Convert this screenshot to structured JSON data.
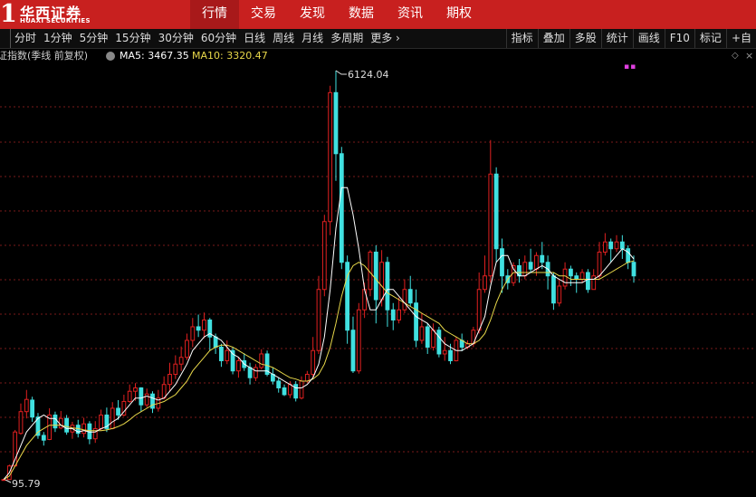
{
  "brand": {
    "mark": "1",
    "name_cn": "华西证券",
    "name_en": "HUAXI SECURITIES"
  },
  "nav": [
    "行情",
    "交易",
    "发现",
    "数据",
    "资讯",
    "期权"
  ],
  "periods": [
    "分时",
    "1分钟",
    "5分钟",
    "15分钟",
    "30分钟",
    "60分钟",
    "日线",
    "周线",
    "月线",
    "多周期",
    "更多"
  ],
  "tools": [
    "指标",
    "叠加",
    "多股",
    "统计",
    "画线",
    "F10",
    "标记",
    "+自"
  ],
  "info": {
    "title": "证指数(季线 前复权)",
    "ma5": "MA5: 3467.35",
    "ma10": "MA10: 3320.47",
    "diamond": "◇",
    "close": "×",
    "dots": "▪▪"
  },
  "chart_data": {
    "type": "candlestick",
    "title": "",
    "annotations": [
      {
        "text": "6124.04",
        "kind": "high"
      },
      {
        "text": "95.79",
        "kind": "low"
      }
    ],
    "grid": "horizontal-dotted",
    "colors": {
      "up": "#e02020",
      "down": "#40e0e0",
      "ma5": "#ffffff",
      "ma10": "#e8d84a",
      "grid": "#7a1a1a"
    },
    "candles": [
      [
        95.79,
        100,
        100,
        95.79
      ],
      [
        100,
        300,
        320,
        100
      ],
      [
        300,
        800,
        830,
        290
      ],
      [
        780,
        1100,
        1220,
        760
      ],
      [
        1100,
        1280,
        1420,
        1000
      ],
      [
        1270,
        1020,
        1320,
        950
      ],
      [
        1020,
        750,
        1080,
        700
      ],
      [
        750,
        680,
        800,
        600
      ],
      [
        690,
        1050,
        1150,
        680
      ],
      [
        1050,
        860,
        1100,
        800
      ],
      [
        860,
        1000,
        1110,
        840
      ],
      [
        1000,
        800,
        1050,
        760
      ],
      [
        800,
        900,
        950,
        700
      ],
      [
        900,
        780,
        980,
        720
      ],
      [
        780,
        920,
        1010,
        720
      ],
      [
        920,
        700,
        960,
        620
      ],
      [
        700,
        850,
        960,
        640
      ],
      [
        850,
        1050,
        1130,
        820
      ],
      [
        1050,
        850,
        1160,
        800
      ],
      [
        850,
        1150,
        1240,
        840
      ],
      [
        1150,
        1050,
        1270,
        980
      ],
      [
        1050,
        1250,
        1350,
        1030
      ],
      [
        1250,
        1400,
        1500,
        1230
      ],
      [
        1400,
        1450,
        1520,
        1260
      ],
      [
        1450,
        1200,
        1460,
        1100
      ],
      [
        1200,
        1360,
        1440,
        1160
      ],
      [
        1360,
        1150,
        1400,
        1080
      ],
      [
        1150,
        1300,
        1420,
        1100
      ],
      [
        1300,
        1500,
        1620,
        1280
      ],
      [
        1500,
        1650,
        1820,
        1400
      ],
      [
        1650,
        1800,
        1930,
        1580
      ],
      [
        1800,
        1900,
        2060,
        1700
      ],
      [
        1900,
        2150,
        2250,
        1860
      ],
      [
        2150,
        2350,
        2480,
        2050
      ],
      [
        2350,
        2300,
        2530,
        2200
      ],
      [
        2300,
        2450,
        2560,
        2180
      ],
      [
        2450,
        2200,
        2480,
        2000
      ],
      [
        2200,
        2050,
        2250,
        1950
      ],
      [
        2050,
        1850,
        2100,
        1760
      ],
      [
        1850,
        2000,
        2150,
        1800
      ],
      [
        2000,
        1700,
        2050,
        1650
      ],
      [
        1700,
        1850,
        1900,
        1600
      ],
      [
        1850,
        1750,
        1960,
        1700
      ],
      [
        1750,
        1600,
        1820,
        1500
      ],
      [
        1600,
        1750,
        1800,
        1550
      ],
      [
        1750,
        1950,
        2020,
        1720
      ],
      [
        1950,
        1650,
        2000,
        1620
      ],
      [
        1650,
        1550,
        1750,
        1500
      ],
      [
        1550,
        1450,
        1600,
        1380
      ],
      [
        1450,
        1350,
        1500,
        1330
      ],
      [
        1350,
        1500,
        1550,
        1300
      ],
      [
        1500,
        1300,
        1550,
        1250
      ],
      [
        1300,
        1550,
        1620,
        1280
      ],
      [
        1550,
        1650,
        1700,
        1520
      ],
      [
        1650,
        2000,
        2200,
        1600
      ],
      [
        2000,
        2900,
        3100,
        1950
      ],
      [
        2900,
        3900,
        4000,
        2800
      ],
      [
        3900,
        5800,
        5900,
        3700
      ],
      [
        5800,
        4900,
        6124.04,
        4500
      ],
      [
        4900,
        3300,
        5000,
        3200
      ],
      [
        3300,
        2300,
        3400,
        2100
      ],
      [
        2300,
        1700,
        2500,
        1670
      ],
      [
        1700,
        2600,
        2700,
        1660
      ],
      [
        2600,
        2900,
        3000,
        2480
      ],
      [
        2900,
        3450,
        3480,
        2800
      ],
      [
        3450,
        2750,
        3550,
        2400
      ],
      [
        2750,
        3300,
        3480,
        2650
      ],
      [
        3300,
        2600,
        3380,
        2350
      ],
      [
        2600,
        2450,
        2700,
        2300
      ],
      [
        2450,
        2600,
        2780,
        2400
      ],
      [
        2600,
        2900,
        3050,
        2550
      ],
      [
        2900,
        2700,
        3100,
        2650
      ],
      [
        2700,
        2150,
        2900,
        2050
      ],
      [
        2150,
        2350,
        2550,
        2100
      ],
      [
        2350,
        2050,
        2400,
        1950
      ],
      [
        2050,
        2300,
        2400,
        2000
      ],
      [
        2300,
        1950,
        2350,
        1900
      ],
      [
        1950,
        2000,
        2200,
        1850
      ],
      [
        2000,
        1850,
        2100,
        1800
      ],
      [
        1850,
        2150,
        2200,
        1840
      ],
      [
        2150,
        2050,
        2250,
        1990
      ],
      [
        2050,
        2100,
        2150,
        2020
      ],
      [
        2100,
        2300,
        2350,
        2050
      ],
      [
        2300,
        2900,
        3150,
        2250
      ],
      [
        2900,
        3100,
        3400,
        2850
      ],
      [
        3100,
        4600,
        5100,
        3000
      ],
      [
        4600,
        3500,
        4700,
        3300
      ],
      [
        3500,
        3100,
        3650,
        2850
      ],
      [
        3100,
        3000,
        3200,
        2900
      ],
      [
        3000,
        3250,
        3300,
        2950
      ],
      [
        3250,
        3100,
        3350,
        3000
      ],
      [
        3100,
        3300,
        3400,
        3050
      ],
      [
        3300,
        3200,
        3500,
        3150
      ],
      [
        3200,
        3400,
        3450,
        3100
      ],
      [
        3400,
        3300,
        3600,
        3200
      ],
      [
        3300,
        3100,
        3400,
        2900
      ],
      [
        3100,
        2700,
        3150,
        2600
      ],
      [
        2700,
        2950,
        3050,
        2650
      ],
      [
        2950,
        3200,
        3300,
        2900
      ],
      [
        3200,
        3100,
        3250,
        2950
      ],
      [
        3100,
        3050,
        3150,
        2850
      ],
      [
        3050,
        3150,
        3200,
        3000
      ],
      [
        3150,
        2900,
        3200,
        2850
      ],
      [
        2900,
        3100,
        3200,
        2900
      ],
      [
        3100,
        3450,
        3600,
        3050
      ],
      [
        3450,
        3600,
        3730,
        3400
      ],
      [
        3600,
        3500,
        3650,
        3300
      ],
      [
        3500,
        3600,
        3700,
        3450
      ],
      [
        3600,
        3500,
        3700,
        3350
      ],
      [
        3500,
        3300,
        3550,
        3200
      ],
      [
        3300,
        3100,
        3400,
        3000
      ]
    ],
    "ma5": [
      100,
      200,
      400,
      600,
      800,
      900,
      1000,
      1050,
      1000,
      1000,
      900,
      850,
      850,
      800,
      820,
      800,
      800,
      850,
      880,
      950,
      1000,
      1100,
      1200,
      1300,
      1300,
      1330,
      1300,
      1270,
      1300,
      1400,
      1500,
      1650,
      1800,
      2000,
      2100,
      2200,
      2250,
      2200,
      2150,
      2050,
      1950,
      1900,
      1800,
      1750,
      1700,
      1700,
      1700,
      1650,
      1600,
      1550,
      1500,
      1450,
      1450,
      1500,
      1600,
      1800,
      2200,
      2900,
      3800,
      4400,
      4400,
      4000,
      3500,
      2900,
      2600,
      2600,
      2750,
      2900,
      2900,
      2800,
      2700,
      2600,
      2500,
      2450,
      2400,
      2300,
      2200,
      2100,
      2050,
      2000,
      2000,
      2050,
      2100,
      2300,
      2500,
      2950,
      3300,
      3400,
      3400,
      3200,
      3100,
      3100,
      3150,
      3200,
      3250,
      3200,
      3100,
      3050,
      3000,
      3000,
      3000,
      3000,
      3050,
      3050,
      3100,
      3200,
      3300,
      3400,
      3500,
      3450,
      3350,
      3250
    ],
    "ma10": [
      100,
      150,
      300,
      450,
      600,
      700,
      800,
      850,
      900,
      900,
      900,
      880,
      860,
      850,
      830,
      820,
      820,
      820,
      830,
      850,
      880,
      920,
      980,
      1050,
      1100,
      1150,
      1200,
      1220,
      1250,
      1300,
      1350,
      1450,
      1550,
      1700,
      1800,
      1900,
      2000,
      2050,
      2080,
      2080,
      2050,
      2000,
      1950,
      1900,
      1850,
      1800,
      1780,
      1750,
      1700,
      1650,
      1600,
      1580,
      1550,
      1550,
      1580,
      1650,
      1800,
      2050,
      2400,
      2800,
      3100,
      3250,
      3300,
      3250,
      3150,
      3050,
      2950,
      2850,
      2800,
      2750,
      2700,
      2650,
      2600,
      2550,
      2500,
      2450,
      2400,
      2300,
      2250,
      2200,
      2150,
      2100,
      2100,
      2150,
      2250,
      2450,
      2700,
      2900,
      3050,
      3150,
      3150,
      3150,
      3150,
      3150,
      3150,
      3150,
      3150,
      3100,
      3100,
      3050,
      3050,
      3050,
      3050,
      3050,
      3050,
      3100,
      3150,
      3200,
      3250,
      3300,
      3320,
      3320
    ]
  }
}
